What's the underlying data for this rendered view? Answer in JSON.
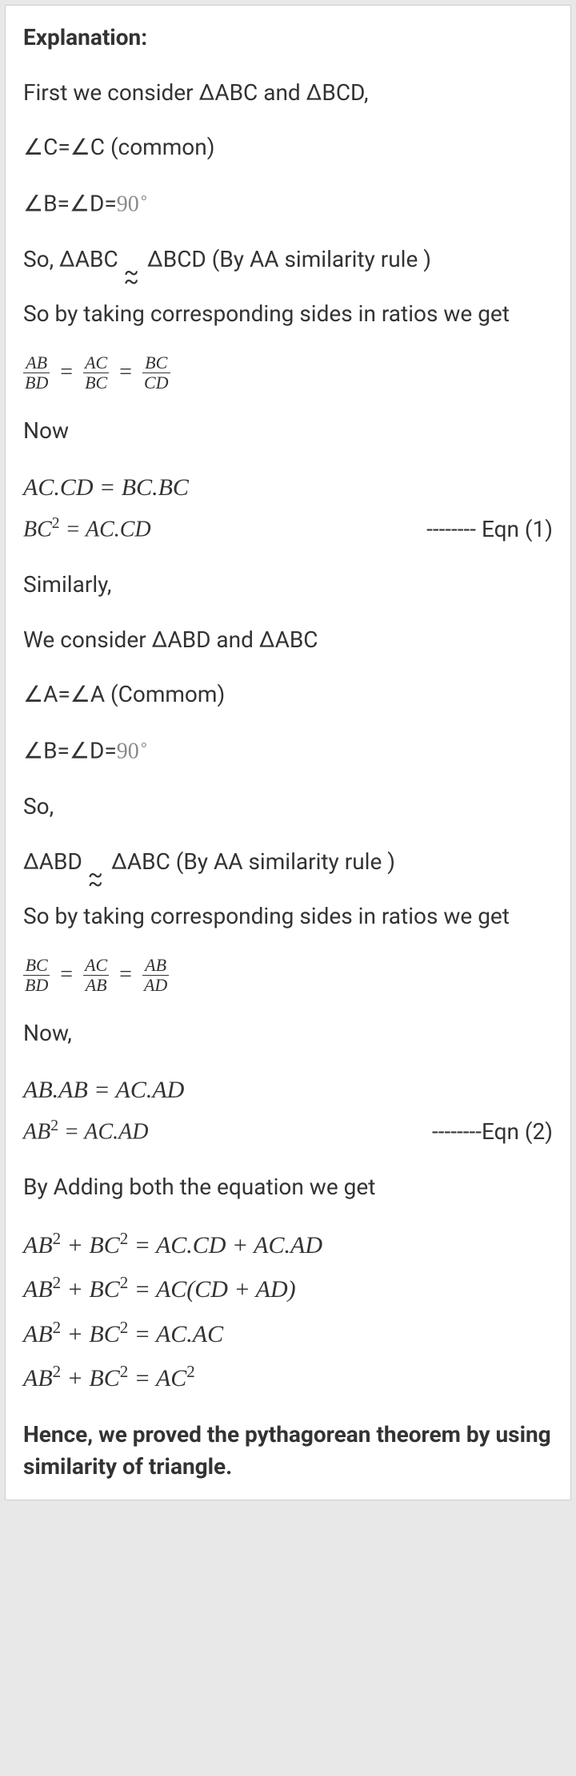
{
  "heading": "Explanation:",
  "p1": "First we consider ΔABC and ΔBCD,",
  "p2_pre": "∠C=∠C",
  "p2_tail": "  (common)",
  "p3_pre": "∠B=∠D=",
  "p3_deg": "90",
  "p4_a": "So, ΔABC ",
  "p4_b": " ΔBCD (By AA similarity rule )",
  "p5": "So by taking corresponding sides in ratios we get",
  "frac1": {
    "a_num": "AB",
    "a_den": "BD",
    "b_num": "AC",
    "b_den": "BC",
    "c_num": "BC",
    "c_den": "CD"
  },
  "p6": "Now",
  "eq1_l1": "AC.CD = BC.BC",
  "eq1_l2a": "BC",
  "eq1_l2b": " = AC.CD",
  "eq1_lbl": "-------- Eqn (1)",
  "p7": "Similarly,",
  "p8": "We consider ΔABD and ΔABC",
  "p9": "∠A=∠A (Commom)",
  "p10_pre": "∠B=∠D=",
  "p10_deg": "90",
  "p11": "So,",
  "p12_a": "ΔABD ",
  "p12_b": " ΔABC (By AA similarity rule )",
  "p13": "So by taking corresponding sides in ratios we get",
  "frac2": {
    "a_num": "BC",
    "a_den": "BD",
    "b_num": "AC",
    "b_den": "AB",
    "c_num": "AB",
    "c_den": "AD"
  },
  "p14": "Now,",
  "eq2_l1": "AB.AB = AC.AD",
  "eq2_l2a": "AB",
  "eq2_l2b": " = AC.AD",
  "eq2_lbl": "--------Eqn (2)",
  "p15": "By Adding both the equation we get",
  "fin1a": "AB",
  "fin1b": " + BC",
  "fin1c": " = AC.CD + AC.AD",
  "fin2a": "AB",
  "fin2b": " + BC",
  "fin2c": " = AC(CD + AD)",
  "fin3a": "AB",
  "fin3b": " + BC",
  "fin3c": " = AC.AC",
  "fin4a": "AB",
  "fin4b": " + BC",
  "fin4c": " = AC",
  "sq": "2",
  "conclusion": "Hence, we proved the pythagorean theorem by using similarity of triangle.",
  "eq": " = ",
  "deg_sym": "∘"
}
